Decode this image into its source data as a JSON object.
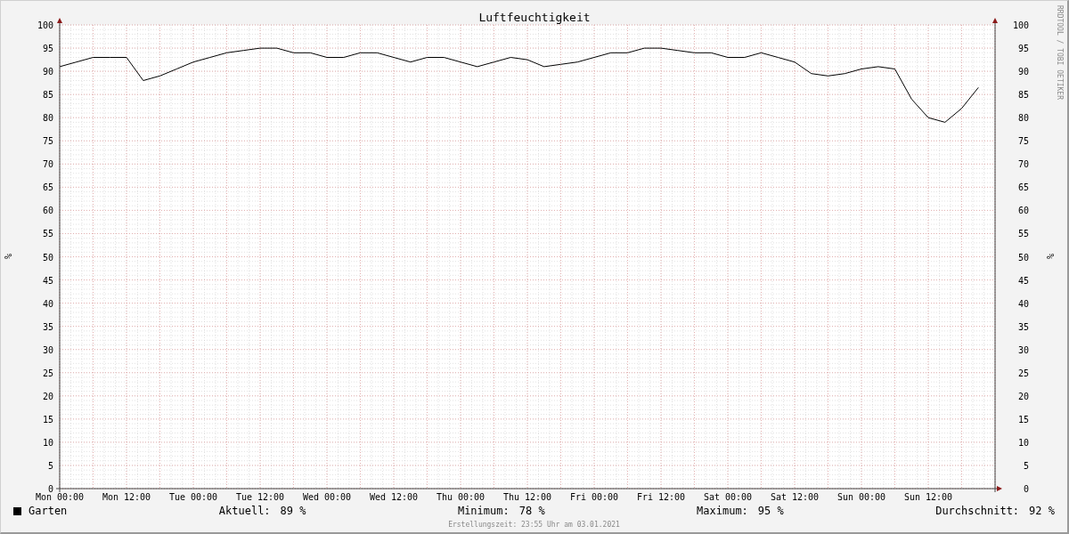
{
  "chart_data": {
    "type": "line",
    "grid": true,
    "title": "Luftfeuchtigkeit",
    "ylabel": "%",
    "ylim": [
      0,
      100
    ],
    "categories": [
      "Mon 00:00",
      null,
      null,
      null,
      "Mon 12:00",
      null,
      null,
      null,
      "Tue 00:00",
      null,
      null,
      null,
      "Tue 12:00",
      null,
      null,
      null,
      "Wed 00:00",
      null,
      null,
      null,
      "Wed 12:00",
      null,
      null,
      null,
      "Thu 00:00",
      null,
      null,
      null,
      "Thu 12:00",
      null,
      null,
      null,
      "Fri 00:00",
      null,
      null,
      null,
      "Fri 12:00",
      null,
      null,
      null,
      "Sat 00:00",
      null,
      null,
      null,
      "Sat 12:00",
      null,
      null,
      null,
      "Sun 00:00",
      null,
      null,
      null,
      "Sun 12:00",
      null,
      null,
      null
    ],
    "yticks": [
      0,
      5,
      10,
      15,
      20,
      25,
      30,
      35,
      40,
      45,
      50,
      55,
      60,
      65,
      70,
      75,
      80,
      85,
      90,
      95,
      100
    ],
    "series": [
      {
        "name": "Garten",
        "color": "#000000",
        "values": [
          91,
          92,
          93,
          93,
          93,
          88,
          89,
          90.5,
          92,
          93,
          94,
          94.5,
          95,
          95,
          94,
          94,
          93,
          93,
          94,
          94,
          93,
          92,
          93,
          93,
          92,
          91,
          92,
          93,
          92.5,
          91,
          91.5,
          92,
          93,
          94,
          94,
          95,
          95,
          94.5,
          94,
          94,
          93,
          93,
          94,
          93,
          92,
          89.5,
          89,
          89.5,
          90.5,
          91,
          90.5,
          84,
          80,
          79,
          82,
          86.5
        ]
      }
    ]
  },
  "right_axis": {
    "label": "%",
    "ticks": [
      "100",
      "95",
      "90",
      "85",
      "80",
      "75",
      "70",
      "65",
      "60",
      "55",
      "50",
      "45",
      "40",
      "35",
      "30",
      "25",
      "20",
      "15",
      "10",
      "5",
      "0"
    ]
  },
  "side_text": "RRDTOOL / TOBI OETIKER",
  "legend": {
    "stats": [
      {
        "label": "Aktuell:",
        "value": "89 %"
      },
      {
        "label": "Minimum:",
        "value": "78 %"
      },
      {
        "label": "Maximum:",
        "value": "95 %"
      },
      {
        "label": "Durchschnitt:",
        "value": "92 %"
      }
    ]
  },
  "footer": "Erstellungszeit: 23:55 Uhr am 03.01.2021"
}
